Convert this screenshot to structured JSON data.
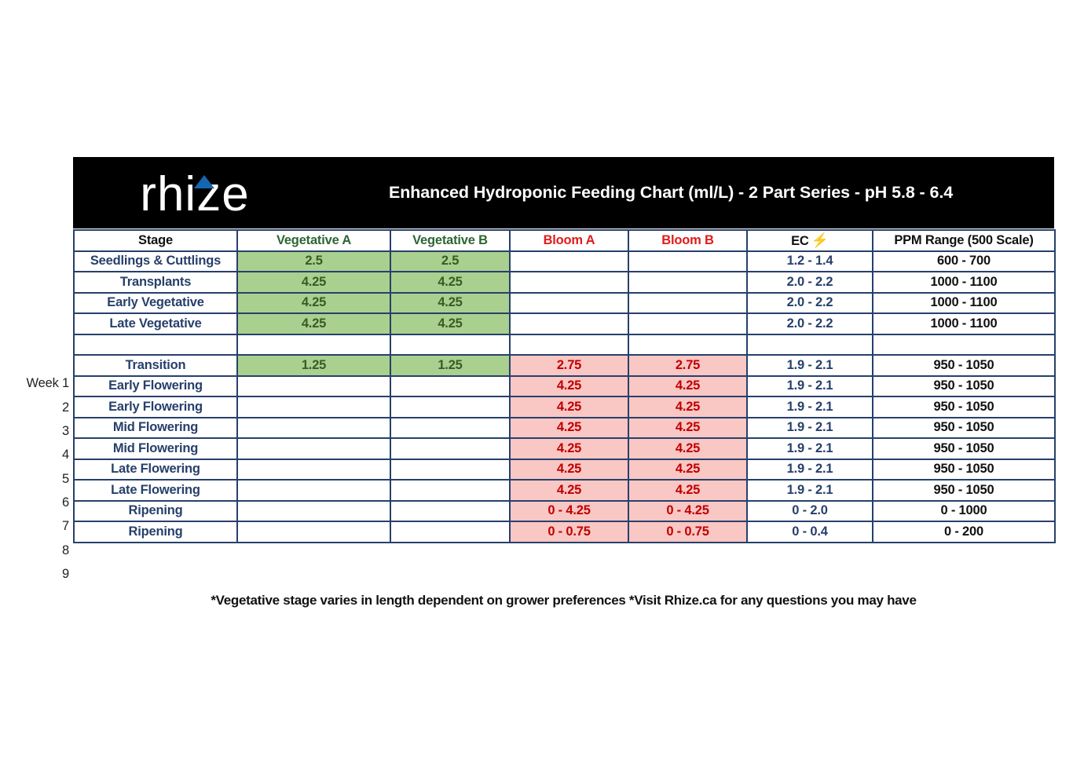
{
  "banner": {
    "logo_text": "rhize",
    "logo_caret_icon": "caret-up-icon",
    "logo_caret_color": "#1565b0",
    "title": "Enhanced Hydroponic Feeding Chart (ml/L) - 2 Part Series - pH 5.8 - 6.4",
    "background_color": "#000000"
  },
  "colors": {
    "border": "#27406b",
    "green_fill": "#a9d08e",
    "green_text": "#3a5a26",
    "pink_fill": "#f9c7c4",
    "pink_text": "#c00000",
    "stage_text": "#27406b",
    "header_green": "#2e6533",
    "header_red": "#e01b1b",
    "ec_text": "#27406b",
    "ppm_text": "#111111"
  },
  "headers": {
    "stage": "Stage",
    "vegetative_a": "Vegetative A",
    "vegetative_b": "Vegetative B",
    "bloom_a": "Bloom A",
    "bloom_b": "Bloom B",
    "ec": "EC",
    "ec_icon": "lightning-bolt-icon",
    "ec_glyph": "⚡",
    "ppm": "PPM Range (500 Scale)"
  },
  "week_labels": [
    "",
    "",
    "",
    "",
    "",
    "Week 1",
    "2",
    "3",
    "4",
    "5",
    "6",
    "7",
    "8",
    "9"
  ],
  "rows": [
    {
      "stage": "Seedlings & Cuttlings",
      "veg_a": "2.5",
      "veg_b": "2.5",
      "bloom_a": "",
      "bloom_b": "",
      "ec": "1.2 - 1.4",
      "ppm": "600 - 700"
    },
    {
      "stage": "Transplants",
      "veg_a": "4.25",
      "veg_b": "4.25",
      "bloom_a": "",
      "bloom_b": "",
      "ec": "2.0 - 2.2",
      "ppm": "1000 - 1100"
    },
    {
      "stage": "Early Vegetative",
      "veg_a": "4.25",
      "veg_b": "4.25",
      "bloom_a": "",
      "bloom_b": "",
      "ec": "2.0 - 2.2",
      "ppm": "1000 - 1100"
    },
    {
      "stage": "Late Vegetative",
      "veg_a": "4.25",
      "veg_b": "4.25",
      "bloom_a": "",
      "bloom_b": "",
      "ec": "2.0 - 2.2",
      "ppm": "1000 - 1100"
    },
    {
      "stage": "",
      "veg_a": "",
      "veg_b": "",
      "bloom_a": "",
      "bloom_b": "",
      "ec": "",
      "ppm": ""
    },
    {
      "stage": "Transition",
      "veg_a": "1.25",
      "veg_b": "1.25",
      "bloom_a": "2.75",
      "bloom_b": "2.75",
      "ec": "1.9 - 2.1",
      "ppm": "950 - 1050"
    },
    {
      "stage": "Early Flowering",
      "veg_a": "",
      "veg_b": "",
      "bloom_a": "4.25",
      "bloom_b": "4.25",
      "ec": "1.9 - 2.1",
      "ppm": "950 - 1050"
    },
    {
      "stage": "Early Flowering",
      "veg_a": "",
      "veg_b": "",
      "bloom_a": "4.25",
      "bloom_b": "4.25",
      "ec": "1.9 - 2.1",
      "ppm": "950 - 1050"
    },
    {
      "stage": "Mid Flowering",
      "veg_a": "",
      "veg_b": "",
      "bloom_a": "4.25",
      "bloom_b": "4.25",
      "ec": "1.9 - 2.1",
      "ppm": "950 - 1050"
    },
    {
      "stage": "Mid Flowering",
      "veg_a": "",
      "veg_b": "",
      "bloom_a": "4.25",
      "bloom_b": "4.25",
      "ec": "1.9 - 2.1",
      "ppm": "950 - 1050"
    },
    {
      "stage": "Late Flowering",
      "veg_a": "",
      "veg_b": "",
      "bloom_a": "4.25",
      "bloom_b": "4.25",
      "ec": "1.9 - 2.1",
      "ppm": "950 - 1050"
    },
    {
      "stage": "Late Flowering",
      "veg_a": "",
      "veg_b": "",
      "bloom_a": "4.25",
      "bloom_b": "4.25",
      "ec": "1.9 - 2.1",
      "ppm": "950 - 1050"
    },
    {
      "stage": "Ripening",
      "veg_a": "",
      "veg_b": "",
      "bloom_a": "0 - 4.25",
      "bloom_b": "0 - 4.25",
      "ec": "0 - 2.0",
      "ppm": "0 - 1000"
    },
    {
      "stage": "Ripening",
      "veg_a": "",
      "veg_b": "",
      "bloom_a": "0 - 0.75",
      "bloom_b": "0 - 0.75",
      "ec": "0 - 0.4",
      "ppm": "0 - 200"
    }
  ],
  "footer_note": "*Vegetative stage varies in length dependent on grower preferences *Visit Rhize.ca for any questions you may have"
}
